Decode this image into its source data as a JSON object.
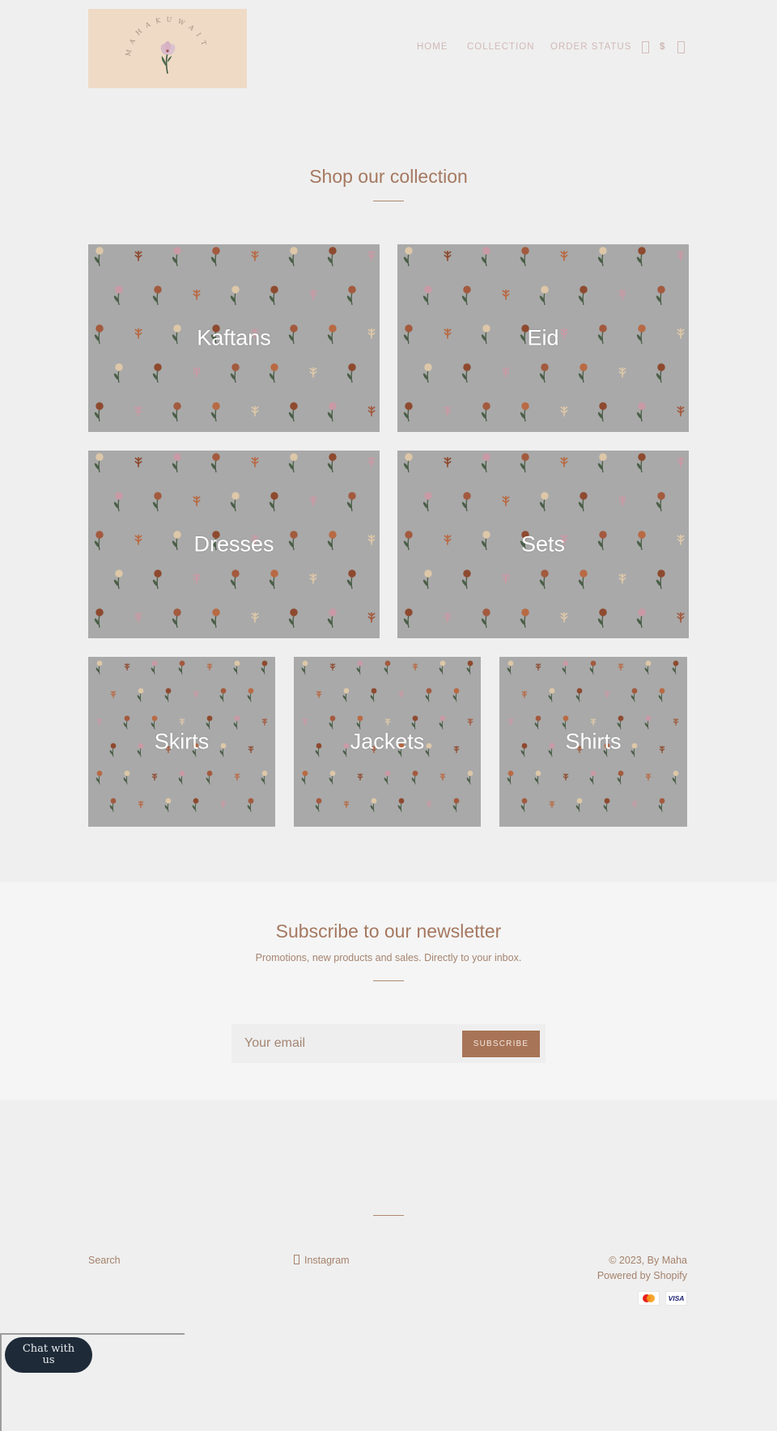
{
  "header": {
    "logo_text": "MAHAKUWAIT",
    "logo_alt": "Maha Kuwait logo",
    "nav": [
      {
        "label": "HOME"
      },
      {
        "label": "COLLECTION"
      },
      {
        "label": "ORDER STATUS"
      }
    ],
    "currency": "$",
    "icons": {
      "account": "user-icon",
      "cart": "cart-icon"
    }
  },
  "collection": {
    "title": "Shop our collection",
    "tiles": [
      {
        "label": "Kaftans"
      },
      {
        "label": "Eid"
      },
      {
        "label": "Dresses"
      },
      {
        "label": "Sets"
      },
      {
        "label": "Skirts"
      },
      {
        "label": "Jackets"
      },
      {
        "label": "Shirts"
      }
    ]
  },
  "newsletter": {
    "title": "Subscribe to our newsletter",
    "subtitle": "Promotions, new products and sales. Directly to your inbox.",
    "email_placeholder": "Your email",
    "email_value": "",
    "button_label": "SUBSCRIBE"
  },
  "footer": {
    "links": [
      {
        "label": "Search"
      },
      {
        "label": "Instagram",
        "icon": "instagram-icon"
      }
    ],
    "copyright": "© 2023, By Maha",
    "powered_by": "Powered by Shopify",
    "payment_methods": [
      "mastercard",
      "VISA"
    ]
  },
  "chat": {
    "label": "Chat with us"
  },
  "colors": {
    "page_bg": "#efefef",
    "accent": "#a87457",
    "heading": "#a57860",
    "logo_bg": "#eedac5",
    "tile_bg": "#a9a9a9",
    "chat_bg": "#1e2a38"
  }
}
